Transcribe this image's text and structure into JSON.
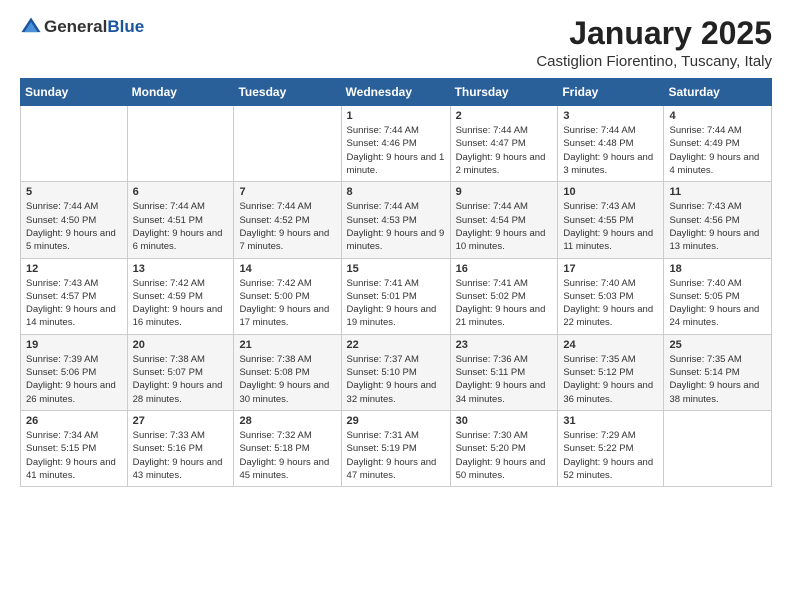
{
  "logo": {
    "general": "General",
    "blue": "Blue"
  },
  "title": "January 2025",
  "location": "Castiglion Fiorentino, Tuscany, Italy",
  "headers": [
    "Sunday",
    "Monday",
    "Tuesday",
    "Wednesday",
    "Thursday",
    "Friday",
    "Saturday"
  ],
  "weeks": [
    [
      {
        "day": "",
        "info": ""
      },
      {
        "day": "",
        "info": ""
      },
      {
        "day": "",
        "info": ""
      },
      {
        "day": "1",
        "info": "Sunrise: 7:44 AM\nSunset: 4:46 PM\nDaylight: 9 hours and 1 minute."
      },
      {
        "day": "2",
        "info": "Sunrise: 7:44 AM\nSunset: 4:47 PM\nDaylight: 9 hours and 2 minutes."
      },
      {
        "day": "3",
        "info": "Sunrise: 7:44 AM\nSunset: 4:48 PM\nDaylight: 9 hours and 3 minutes."
      },
      {
        "day": "4",
        "info": "Sunrise: 7:44 AM\nSunset: 4:49 PM\nDaylight: 9 hours and 4 minutes."
      }
    ],
    [
      {
        "day": "5",
        "info": "Sunrise: 7:44 AM\nSunset: 4:50 PM\nDaylight: 9 hours and 5 minutes."
      },
      {
        "day": "6",
        "info": "Sunrise: 7:44 AM\nSunset: 4:51 PM\nDaylight: 9 hours and 6 minutes."
      },
      {
        "day": "7",
        "info": "Sunrise: 7:44 AM\nSunset: 4:52 PM\nDaylight: 9 hours and 7 minutes."
      },
      {
        "day": "8",
        "info": "Sunrise: 7:44 AM\nSunset: 4:53 PM\nDaylight: 9 hours and 9 minutes."
      },
      {
        "day": "9",
        "info": "Sunrise: 7:44 AM\nSunset: 4:54 PM\nDaylight: 9 hours and 10 minutes."
      },
      {
        "day": "10",
        "info": "Sunrise: 7:43 AM\nSunset: 4:55 PM\nDaylight: 9 hours and 11 minutes."
      },
      {
        "day": "11",
        "info": "Sunrise: 7:43 AM\nSunset: 4:56 PM\nDaylight: 9 hours and 13 minutes."
      }
    ],
    [
      {
        "day": "12",
        "info": "Sunrise: 7:43 AM\nSunset: 4:57 PM\nDaylight: 9 hours and 14 minutes."
      },
      {
        "day": "13",
        "info": "Sunrise: 7:42 AM\nSunset: 4:59 PM\nDaylight: 9 hours and 16 minutes."
      },
      {
        "day": "14",
        "info": "Sunrise: 7:42 AM\nSunset: 5:00 PM\nDaylight: 9 hours and 17 minutes."
      },
      {
        "day": "15",
        "info": "Sunrise: 7:41 AM\nSunset: 5:01 PM\nDaylight: 9 hours and 19 minutes."
      },
      {
        "day": "16",
        "info": "Sunrise: 7:41 AM\nSunset: 5:02 PM\nDaylight: 9 hours and 21 minutes."
      },
      {
        "day": "17",
        "info": "Sunrise: 7:40 AM\nSunset: 5:03 PM\nDaylight: 9 hours and 22 minutes."
      },
      {
        "day": "18",
        "info": "Sunrise: 7:40 AM\nSunset: 5:05 PM\nDaylight: 9 hours and 24 minutes."
      }
    ],
    [
      {
        "day": "19",
        "info": "Sunrise: 7:39 AM\nSunset: 5:06 PM\nDaylight: 9 hours and 26 minutes."
      },
      {
        "day": "20",
        "info": "Sunrise: 7:38 AM\nSunset: 5:07 PM\nDaylight: 9 hours and 28 minutes."
      },
      {
        "day": "21",
        "info": "Sunrise: 7:38 AM\nSunset: 5:08 PM\nDaylight: 9 hours and 30 minutes."
      },
      {
        "day": "22",
        "info": "Sunrise: 7:37 AM\nSunset: 5:10 PM\nDaylight: 9 hours and 32 minutes."
      },
      {
        "day": "23",
        "info": "Sunrise: 7:36 AM\nSunset: 5:11 PM\nDaylight: 9 hours and 34 minutes."
      },
      {
        "day": "24",
        "info": "Sunrise: 7:35 AM\nSunset: 5:12 PM\nDaylight: 9 hours and 36 minutes."
      },
      {
        "day": "25",
        "info": "Sunrise: 7:35 AM\nSunset: 5:14 PM\nDaylight: 9 hours and 38 minutes."
      }
    ],
    [
      {
        "day": "26",
        "info": "Sunrise: 7:34 AM\nSunset: 5:15 PM\nDaylight: 9 hours and 41 minutes."
      },
      {
        "day": "27",
        "info": "Sunrise: 7:33 AM\nSunset: 5:16 PM\nDaylight: 9 hours and 43 minutes."
      },
      {
        "day": "28",
        "info": "Sunrise: 7:32 AM\nSunset: 5:18 PM\nDaylight: 9 hours and 45 minutes."
      },
      {
        "day": "29",
        "info": "Sunrise: 7:31 AM\nSunset: 5:19 PM\nDaylight: 9 hours and 47 minutes."
      },
      {
        "day": "30",
        "info": "Sunrise: 7:30 AM\nSunset: 5:20 PM\nDaylight: 9 hours and 50 minutes."
      },
      {
        "day": "31",
        "info": "Sunrise: 7:29 AM\nSunset: 5:22 PM\nDaylight: 9 hours and 52 minutes."
      },
      {
        "day": "",
        "info": ""
      }
    ]
  ]
}
